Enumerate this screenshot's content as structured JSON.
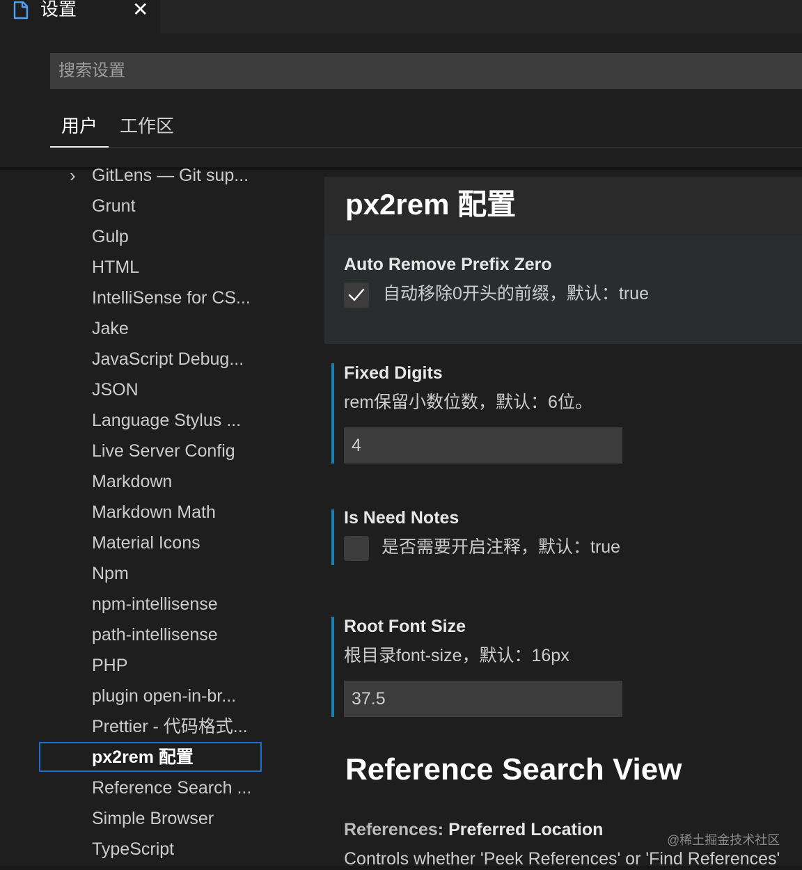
{
  "tab": {
    "title": "设置",
    "close_glyph": "✕",
    "icon": "file-icon"
  },
  "search": {
    "placeholder": "搜索设置",
    "value": ""
  },
  "scope_tabs": [
    {
      "label": "用户",
      "active": true
    },
    {
      "label": "工作区",
      "active": false
    }
  ],
  "tree": {
    "expand_glyph": "›",
    "items": [
      "GitLens — Git sup...",
      "Grunt",
      "Gulp",
      "HTML",
      "IntelliSense for CS...",
      "Jake",
      "JavaScript Debug...",
      "JSON",
      "Language Stylus ...",
      "Live Server Config",
      "Markdown",
      "Markdown Math",
      "Material Icons",
      "Npm",
      "npm-intellisense",
      "path-intellisense",
      "PHP",
      "plugin open-in-br...",
      "Prettier - 代码格式...",
      "px2rem 配置",
      "Reference Search ...",
      "Simple Browser",
      "TypeScript"
    ],
    "selected": "px2rem 配置"
  },
  "section": {
    "title": "px2rem 配置"
  },
  "settings": {
    "auto_remove": {
      "title": "Auto Remove Prefix Zero",
      "description": "自动移除0开头的前缀，默认：true",
      "checked": true
    },
    "fixed_digits": {
      "title": "Fixed Digits",
      "description": "rem保留小数位数，默认：6位。",
      "value": "4"
    },
    "is_need_notes": {
      "title": "Is Need Notes",
      "description": "是否需要开启注释，默认：true",
      "checked": false
    },
    "root_font_size": {
      "title": "Root Font Size",
      "description": "根目录font-size，默认：16px",
      "value": "37.5"
    }
  },
  "reference_section": {
    "title": "Reference Search View",
    "setting_category": "References: ",
    "setting_name": "Preferred Location",
    "description": "Controls whether 'Peek References' or 'Find References'"
  },
  "watermark": "@稀土掘金技术社区",
  "colors": {
    "accent_focus": "#1f6fd1",
    "modified_bar": "#1b80b2",
    "background": "#1e1e1e"
  }
}
